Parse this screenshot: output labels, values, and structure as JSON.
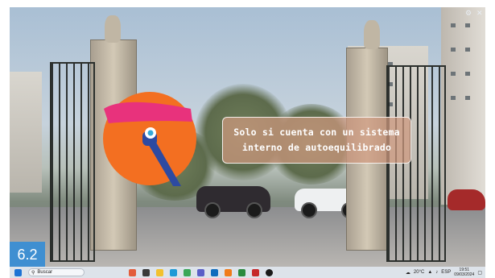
{
  "video": {
    "caption_line1": "Solo si cuenta con un sistema",
    "caption_line2": "interno de autoequilibrado",
    "section_badge": "6.2"
  },
  "taskbar": {
    "search_placeholder": "Buscar",
    "weather": "20°C",
    "language": "ESP",
    "time": "19:51",
    "date": "09/03/2024"
  },
  "colors": {
    "logo_orange": "#f36f21",
    "logo_pink": "#e8327c",
    "logo_blue": "#2d4aa1",
    "badge_blue": "#3f8fd1"
  },
  "icons": [
    "windows-start-icon",
    "search-icon",
    "widgets-icon",
    "task-view-icon",
    "explorer-icon",
    "edge-icon",
    "chrome-icon",
    "store-icon",
    "mail-icon",
    "media-player-icon",
    "weather-icon",
    "network-icon",
    "volume-icon",
    "battery-icon",
    "notification-icon"
  ]
}
